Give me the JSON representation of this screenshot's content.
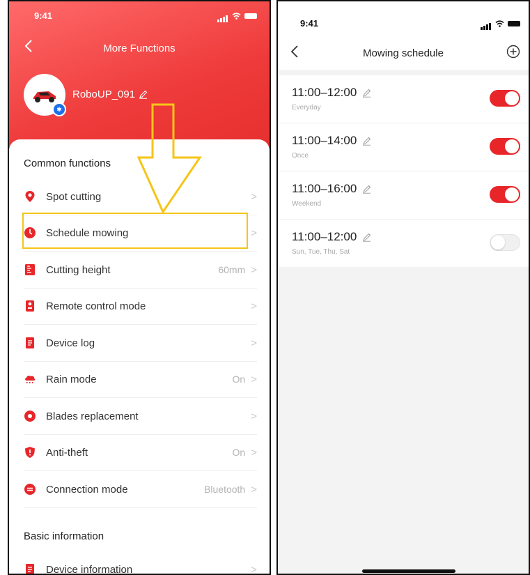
{
  "left": {
    "status_time": "9:41",
    "title": "More Functions",
    "device_name": "RoboUP_091",
    "section_common": "Common functions",
    "section_basic": "Basic information",
    "items": [
      {
        "label": "Spot cutting",
        "value": "",
        "icon": "location-pin-icon"
      },
      {
        "label": "Schedule mowing",
        "value": "",
        "icon": "clock-icon"
      },
      {
        "label": "Cutting height",
        "value": "60mm",
        "icon": "ruler-icon"
      },
      {
        "label": "Remote control mode",
        "value": "",
        "icon": "remote-control-icon"
      },
      {
        "label": "Device log",
        "value": "",
        "icon": "document-icon"
      },
      {
        "label": "Rain mode",
        "value": "On",
        "icon": "rain-cloud-icon"
      },
      {
        "label": "Blades replacement",
        "value": "",
        "icon": "blade-icon"
      },
      {
        "label": "Anti-theft",
        "value": "On",
        "icon": "shield-icon"
      },
      {
        "label": "Connection mode",
        "value": "Bluetooth",
        "icon": "link-icon"
      }
    ],
    "basic_items": [
      {
        "label": "Device information",
        "value": "",
        "icon": "document-icon"
      }
    ],
    "chevron": ">"
  },
  "right": {
    "status_time": "9:41",
    "title": "Mowing schedule",
    "back": "<",
    "schedules": [
      {
        "time": "11:00–12:00",
        "repeat": "Everyday",
        "enabled": true
      },
      {
        "time": "11:00–14:00",
        "repeat": "Once",
        "enabled": true
      },
      {
        "time": "11:00–16:00",
        "repeat": "Weekend",
        "enabled": true
      },
      {
        "time": "11:00–12:00",
        "repeat": "Sun, Tue, Thu, Sat",
        "enabled": false
      }
    ]
  },
  "colors": {
    "accent": "#e8262a",
    "highlight": "#f5c518",
    "bluetooth": "#1e6fe8"
  }
}
